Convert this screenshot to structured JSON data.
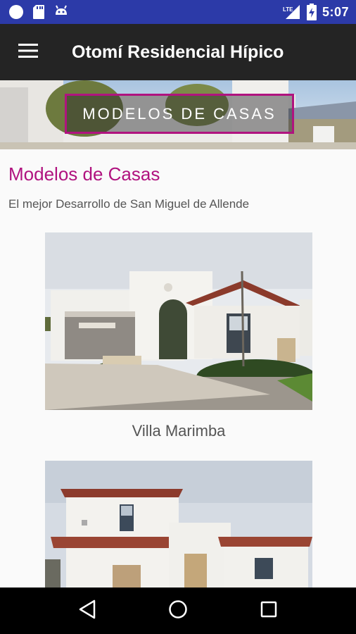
{
  "status_bar": {
    "time": "5:07",
    "network": "LTE",
    "bg_color": "#2c3aa8",
    "icons": [
      "circle-notification-icon",
      "sd-card-icon",
      "android-icon",
      "lte-signal-icon",
      "battery-charging-icon"
    ]
  },
  "app_bar": {
    "title": "Otomí Residencial Hípico",
    "menu_icon": "hamburger-menu-icon",
    "bg_color": "#242424"
  },
  "banner": {
    "text": "MODELOS DE CASAS",
    "border_color": "#b0137f"
  },
  "main": {
    "title": "Modelos de Casas",
    "subtitle": "El mejor Desarrollo de San Miguel de Allende",
    "accent_color": "#b0137f",
    "houses": [
      {
        "name": "Villa Marimba"
      },
      {
        "name": ""
      }
    ]
  },
  "nav_bar": {
    "icons": [
      "back-triangle-icon",
      "home-circle-icon",
      "recents-square-icon"
    ]
  }
}
